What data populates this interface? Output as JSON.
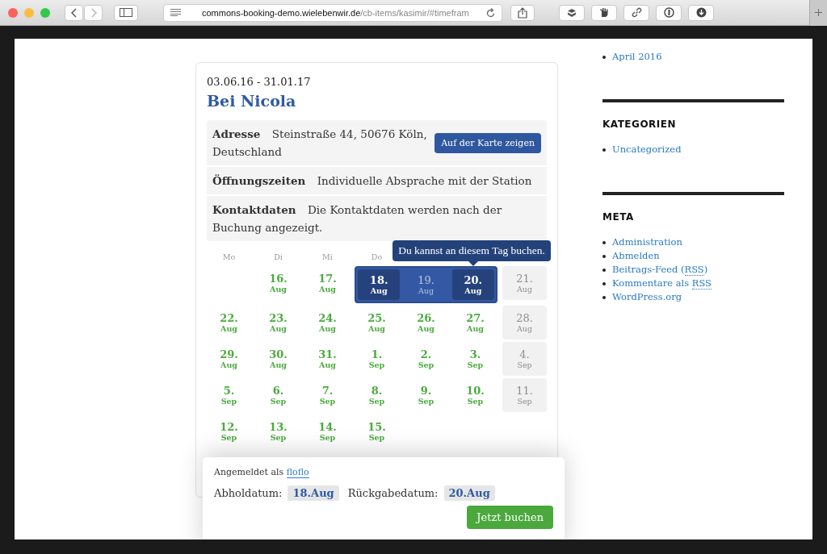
{
  "browser": {
    "url_host": "commons-booking-demo.wielebenwir.de",
    "url_path": "/cb-items/kasimir/#timefram"
  },
  "sidebar": {
    "top_links": [
      "April 2016"
    ],
    "widgets": [
      {
        "title": "KATEGORIEN",
        "links": [
          "Uncategorized"
        ]
      },
      {
        "title": "META",
        "links": [
          "Administration",
          "Abmelden",
          {
            "text": "Beitrags-Feed (",
            "abbr": "RSS",
            "suffix": ")"
          },
          {
            "text": "Kommentare als ",
            "abbr": "RSS"
          },
          "WordPress.org"
        ]
      }
    ]
  },
  "timeframe": {
    "dates": "03.06.16 - 31.01.17",
    "location": "Bei Nicola",
    "details": [
      {
        "label": "Adresse",
        "value": "Steinstraße 44, 50676 Köln, Deutschland",
        "button": "Auf der Karte zeigen"
      },
      {
        "label": "Öffnungszeiten",
        "value": "Individuelle Absprache mit der Station"
      },
      {
        "label": "Kontaktdaten",
        "value": "Die Kontaktdaten werden nach der Buchung angezeigt."
      }
    ],
    "weekdays": [
      "Mo",
      "Di",
      "Mi",
      "Do"
    ],
    "tooltip": "Du kannst an diesem Tag buchen.",
    "weeks": [
      [
        {
          "kind": "empty"
        },
        {
          "kind": "open",
          "day": "16.",
          "month": "Aug",
          "selected": false,
          "in_range": false
        },
        {
          "kind": "open",
          "day": "17.",
          "month": "Aug",
          "selected": false,
          "in_range": false
        },
        {
          "kind": "open",
          "day": "18.",
          "month": "Aug",
          "selected": true,
          "in_range": true
        },
        {
          "kind": "open",
          "day": "19.",
          "month": "Aug",
          "selected": false,
          "in_range": true
        },
        {
          "kind": "open",
          "day": "20.",
          "month": "Aug",
          "selected": true,
          "in_range": true,
          "tooltip": true
        },
        {
          "kind": "closed",
          "day": "21.",
          "month": "Aug",
          "selected": false,
          "in_range": false
        }
      ],
      [
        {
          "kind": "open",
          "day": "22.",
          "month": "Aug",
          "selected": false,
          "in_range": false
        },
        {
          "kind": "open",
          "day": "23.",
          "month": "Aug",
          "selected": false,
          "in_range": false
        },
        {
          "kind": "open",
          "day": "24.",
          "month": "Aug",
          "selected": false,
          "in_range": false
        },
        {
          "kind": "open",
          "day": "25.",
          "month": "Aug",
          "selected": false,
          "in_range": false
        },
        {
          "kind": "open",
          "day": "26.",
          "month": "Aug",
          "selected": false,
          "in_range": false
        },
        {
          "kind": "open",
          "day": "27.",
          "month": "Aug",
          "selected": false,
          "in_range": false
        },
        {
          "kind": "closed",
          "day": "28.",
          "month": "Aug",
          "selected": false,
          "in_range": false
        }
      ],
      [
        {
          "kind": "open",
          "day": "29.",
          "month": "Aug",
          "selected": false,
          "in_range": false
        },
        {
          "kind": "open",
          "day": "30.",
          "month": "Aug",
          "selected": false,
          "in_range": false
        },
        {
          "kind": "open",
          "day": "31.",
          "month": "Aug",
          "selected": false,
          "in_range": false
        },
        {
          "kind": "open",
          "day": "1.",
          "month": "Sep",
          "selected": false,
          "in_range": false
        },
        {
          "kind": "open",
          "day": "2.",
          "month": "Sep",
          "selected": false,
          "in_range": false
        },
        {
          "kind": "open",
          "day": "3.",
          "month": "Sep",
          "selected": false,
          "in_range": false
        },
        {
          "kind": "closed",
          "day": "4.",
          "month": "Sep",
          "selected": false,
          "in_range": false
        }
      ],
      [
        {
          "kind": "open",
          "day": "5.",
          "month": "Sep",
          "selected": false,
          "in_range": false
        },
        {
          "kind": "open",
          "day": "6.",
          "month": "Sep",
          "selected": false,
          "in_range": false
        },
        {
          "kind": "open",
          "day": "7.",
          "month": "Sep",
          "selected": false,
          "in_range": false
        },
        {
          "kind": "open",
          "day": "8.",
          "month": "Sep",
          "selected": false,
          "in_range": false
        },
        {
          "kind": "open",
          "day": "9.",
          "month": "Sep",
          "selected": false,
          "in_range": false
        },
        {
          "kind": "open",
          "day": "10.",
          "month": "Sep",
          "selected": false,
          "in_range": false
        },
        {
          "kind": "closed",
          "day": "11.",
          "month": "Sep",
          "selected": false,
          "in_range": false
        }
      ],
      [
        {
          "kind": "open",
          "day": "12.",
          "month": "Sep",
          "selected": false,
          "in_range": false
        },
        {
          "kind": "open",
          "day": "13.",
          "month": "Sep",
          "selected": false,
          "in_range": false
        },
        {
          "kind": "open",
          "day": "14.",
          "month": "Sep",
          "selected": false,
          "in_range": false
        },
        {
          "kind": "open",
          "day": "15.",
          "month": "Sep",
          "selected": false,
          "in_range": false
        }
      ]
    ]
  },
  "booking": {
    "logged_in_as": "Angemeldet als",
    "user": "floflo",
    "pickup_label": "Abholdatum:",
    "pickup": "18.Aug",
    "return_label": "Rückgabedatum:",
    "return": "20.Aug",
    "submit": "Jetzt buchen"
  }
}
